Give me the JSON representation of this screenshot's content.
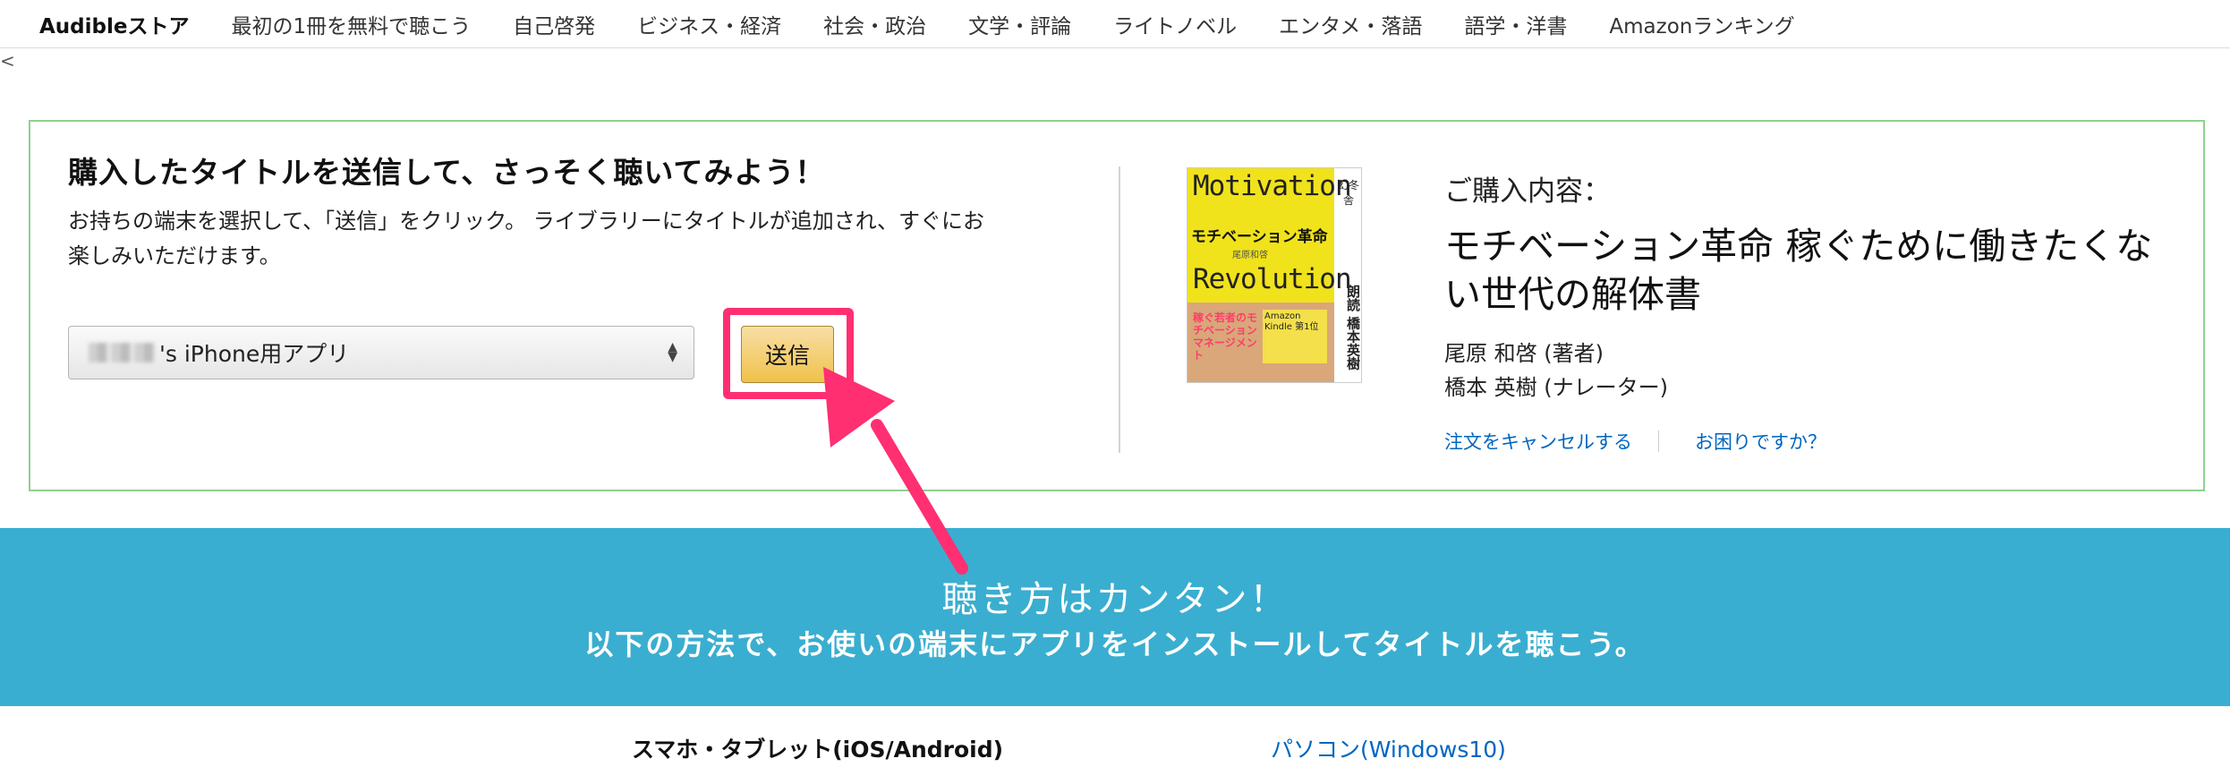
{
  "nav": {
    "brand": "Audibleストア",
    "items": [
      "最初の1冊を無料で聴こう",
      "自己啓発",
      "ビジネス・経済",
      "社会・政治",
      "文学・評論",
      "ライトノベル",
      "エンタメ・落語",
      "語学・洋書",
      "Amazonランキング"
    ]
  },
  "back_glyph": "<",
  "send_section": {
    "headline": "購入したタイトルを送信して、さっそく聴いてみよう！",
    "description_line1": "お持ちの端末を選択して、「送信」をクリック。 ライブラリーにタイトルが追加され、すぐにお",
    "description_line2": "楽しみいただけます。",
    "device_select_value": "'s iPhone用アプリ",
    "send_button": "送信"
  },
  "cover": {
    "word_top": "Motivation",
    "word_bottom": "Revolution",
    "jp_title": "モチベーション革命",
    "author_small": "尾原和啓",
    "publisher": "幻冬舎",
    "narration": "朗読 橋本英樹",
    "lower_left_text": "稼ぐ若者のモチベーションマネージメント",
    "lower_right_text": "Amazon Kindle 第1位"
  },
  "purchase": {
    "label": "ご購入内容：",
    "title": "モチベーション革命 稼ぐために働きたくない世代の解体書",
    "author": "尾原 和啓 (著者)",
    "narrator": "橋本 英樹 (ナレーター)",
    "cancel_link": "注文をキャンセルする",
    "help_link": "お困りですか？"
  },
  "banner": {
    "title": "聴き方はカンタン！",
    "subtitle": "以下の方法で、お使いの端末にアプリをインストールしてタイトルを聴こう。"
  },
  "tabs": {
    "mobile": "スマホ・タブレット(iOS/Android)",
    "pc": "パソコン(Windows10)"
  },
  "colors": {
    "highlight": "#ff2f72",
    "banner": "#3aaed0",
    "panel_border": "#8fd18f",
    "link": "#0066c0",
    "send_button": "#f0c14b"
  }
}
